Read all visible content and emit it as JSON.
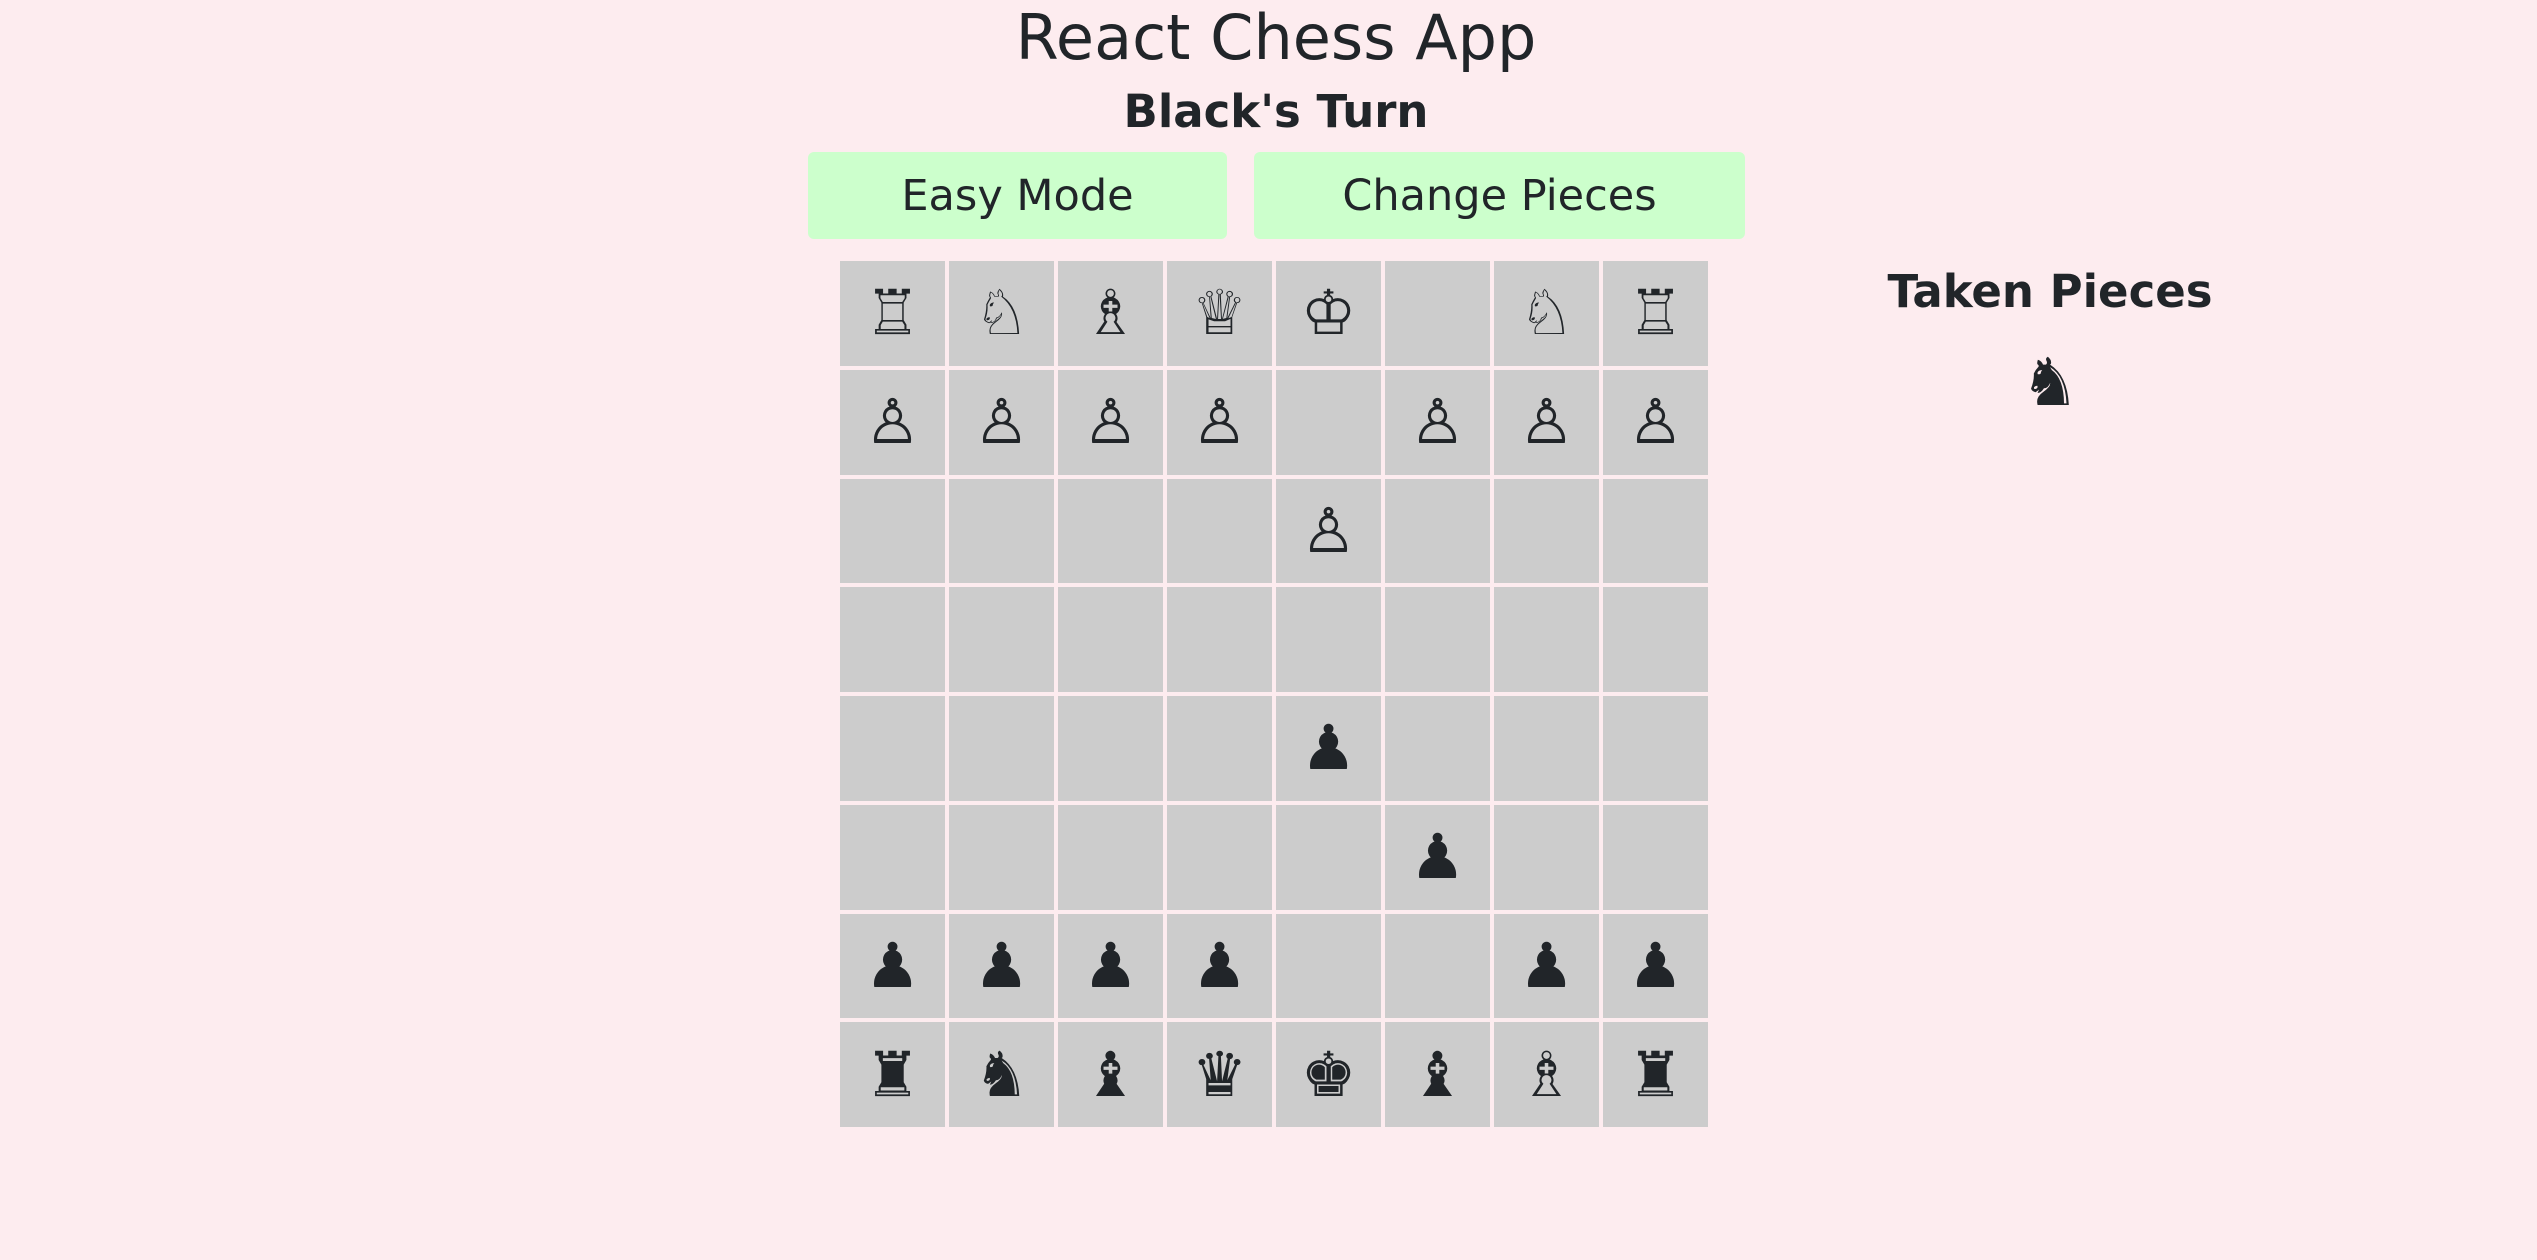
{
  "app": {
    "title": "React Chess App",
    "turn": "Black's Turn"
  },
  "controls": {
    "easy_mode_label": "Easy Mode",
    "change_pieces_label": "Change Pieces"
  },
  "board": {
    "rows": [
      [
        "wR",
        "wN",
        "wB",
        "wQ",
        "wK",
        "",
        "wN",
        "wR"
      ],
      [
        "wP",
        "wP",
        "wP",
        "wP",
        "",
        "wP",
        "wP",
        "wP"
      ],
      [
        "",
        "",
        "",
        "",
        "wP",
        "",
        "",
        ""
      ],
      [
        "",
        "",
        "",
        "",
        "",
        "",
        "",
        ""
      ],
      [
        "",
        "",
        "",
        "",
        "bP",
        "",
        "",
        ""
      ],
      [
        "",
        "",
        "",
        "",
        "",
        "bP",
        "",
        ""
      ],
      [
        "bP",
        "bP",
        "bP",
        "bP",
        "",
        "",
        "bP",
        "bP"
      ],
      [
        "bR",
        "bN",
        "bB",
        "bQ",
        "bK",
        "bB",
        "wB",
        "bR"
      ]
    ],
    "square_color": "#cccccc"
  },
  "taken": {
    "title": "Taken Pieces",
    "pieces": [
      "bN"
    ]
  },
  "colors": {
    "background": "#fdecef",
    "button": "#ccffcc"
  }
}
